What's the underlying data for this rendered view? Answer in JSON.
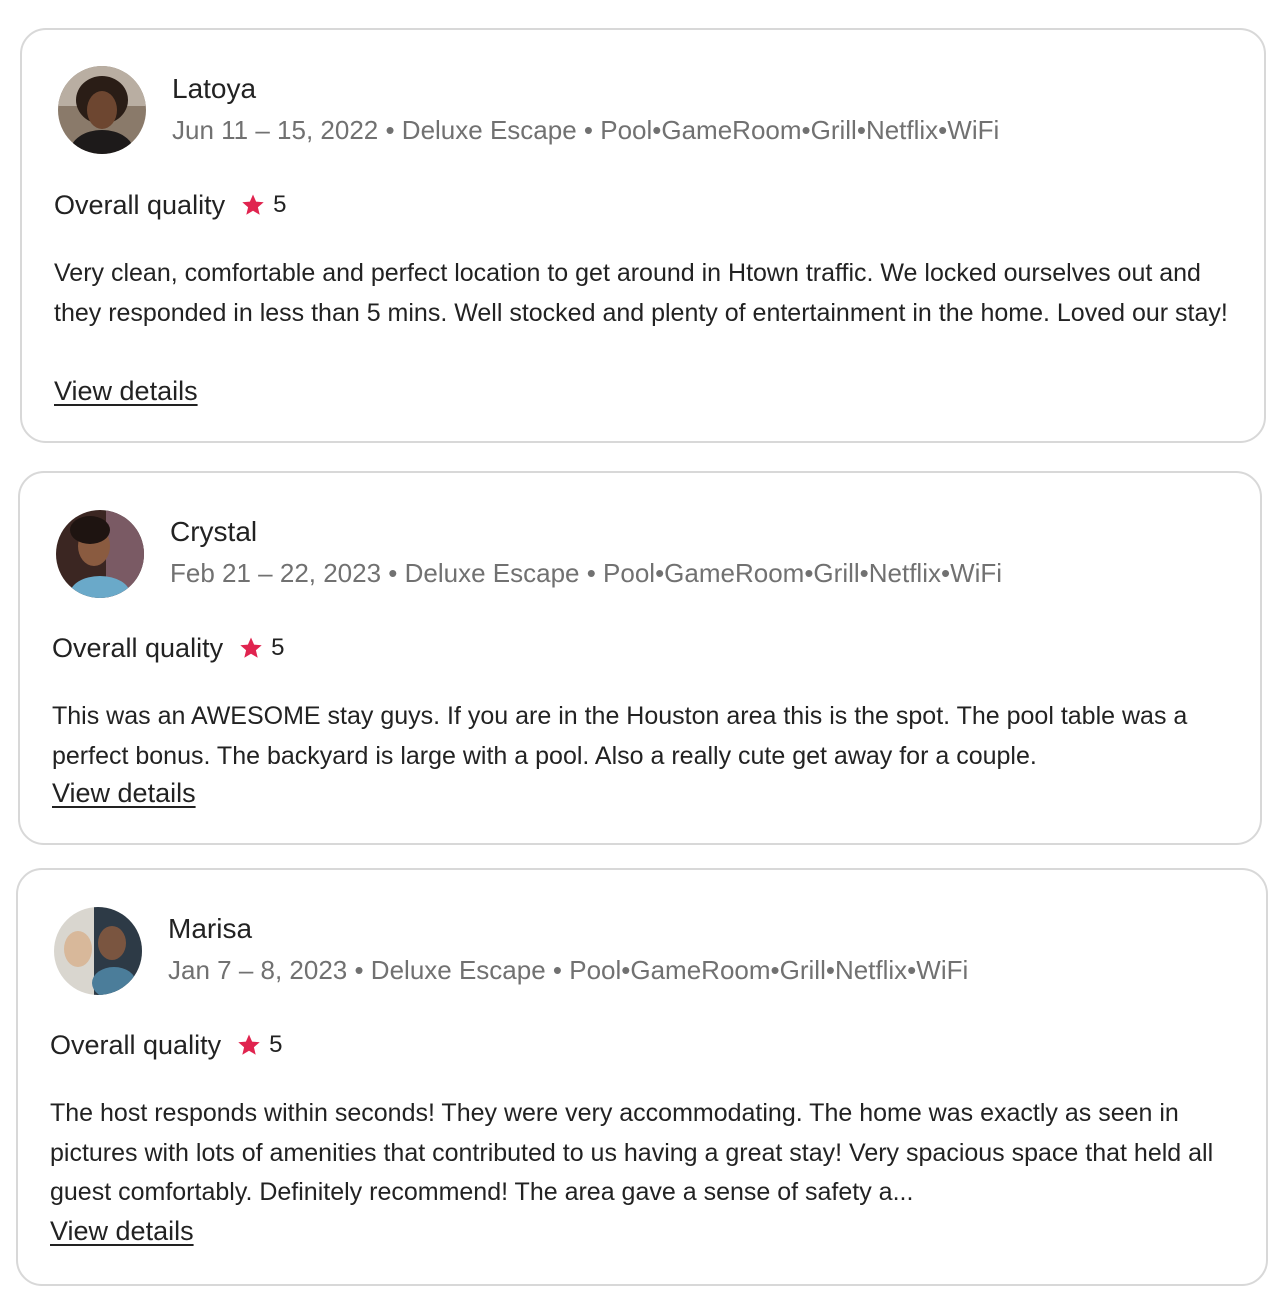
{
  "reviews": [
    {
      "name": "Latoya",
      "meta": "Jun 11 – 15, 2022 • Deluxe Escape • Pool•GameRoom•Grill•Netflix•WiFi",
      "rating_label": "Overall quality",
      "rating": "5",
      "text": "Very clean, comfortable and perfect location to get around in Htown traffic. We locked ourselves out and they responded in less than 5 mins. Well stocked and plenty of entertainment in the home. Loved our stay!",
      "link": "View details"
    },
    {
      "name": "Crystal",
      "meta": "Feb 21 – 22, 2023 • Deluxe Escape • Pool•GameRoom•Grill•Netflix•WiFi",
      "rating_label": "Overall quality",
      "rating": "5",
      "text": "This was an AWESOME stay guys. If you are in the Houston area this is the spot. The pool table was a perfect bonus. The backyard is large with a pool. Also a really cute get away for a couple.",
      "link": "View details"
    },
    {
      "name": "Marisa",
      "meta": "Jan 7 – 8, 2023 • Deluxe Escape • Pool•GameRoom•Grill•Netflix•WiFi",
      "rating_label": "Overall quality",
      "rating": "5",
      "text": "The host responds within seconds! They were very accommodating. The home was exactly as seen in pictures with lots of amenities that contributed to us having a great stay! Very spacious space that held all guest comfortably. Definitely recommend! The area gave a sense of safety a...",
      "link": "View details"
    }
  ],
  "colors": {
    "star": "#e0244f",
    "border": "#d8d8d8",
    "muted_text": "#717171",
    "text": "#222222"
  },
  "icons": {
    "rating": "star-icon"
  }
}
